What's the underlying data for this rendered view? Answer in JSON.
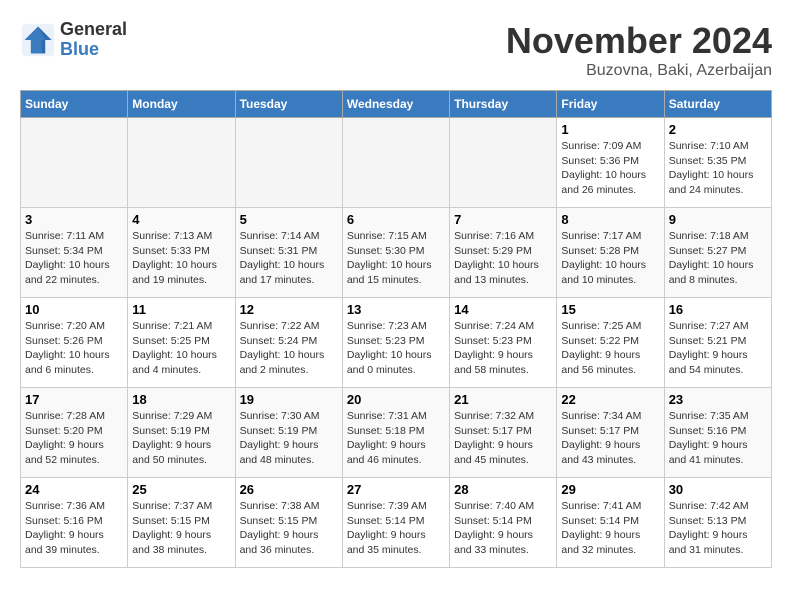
{
  "logo": {
    "general": "General",
    "blue": "Blue"
  },
  "header": {
    "month": "November 2024",
    "location": "Buzovna, Baki, Azerbaijan"
  },
  "weekdays": [
    "Sunday",
    "Monday",
    "Tuesday",
    "Wednesday",
    "Thursday",
    "Friday",
    "Saturday"
  ],
  "weeks": [
    [
      {
        "day": "",
        "info": ""
      },
      {
        "day": "",
        "info": ""
      },
      {
        "day": "",
        "info": ""
      },
      {
        "day": "",
        "info": ""
      },
      {
        "day": "",
        "info": ""
      },
      {
        "day": "1",
        "info": "Sunrise: 7:09 AM\nSunset: 5:36 PM\nDaylight: 10 hours and 26 minutes."
      },
      {
        "day": "2",
        "info": "Sunrise: 7:10 AM\nSunset: 5:35 PM\nDaylight: 10 hours and 24 minutes."
      }
    ],
    [
      {
        "day": "3",
        "info": "Sunrise: 7:11 AM\nSunset: 5:34 PM\nDaylight: 10 hours and 22 minutes."
      },
      {
        "day": "4",
        "info": "Sunrise: 7:13 AM\nSunset: 5:33 PM\nDaylight: 10 hours and 19 minutes."
      },
      {
        "day": "5",
        "info": "Sunrise: 7:14 AM\nSunset: 5:31 PM\nDaylight: 10 hours and 17 minutes."
      },
      {
        "day": "6",
        "info": "Sunrise: 7:15 AM\nSunset: 5:30 PM\nDaylight: 10 hours and 15 minutes."
      },
      {
        "day": "7",
        "info": "Sunrise: 7:16 AM\nSunset: 5:29 PM\nDaylight: 10 hours and 13 minutes."
      },
      {
        "day": "8",
        "info": "Sunrise: 7:17 AM\nSunset: 5:28 PM\nDaylight: 10 hours and 10 minutes."
      },
      {
        "day": "9",
        "info": "Sunrise: 7:18 AM\nSunset: 5:27 PM\nDaylight: 10 hours and 8 minutes."
      }
    ],
    [
      {
        "day": "10",
        "info": "Sunrise: 7:20 AM\nSunset: 5:26 PM\nDaylight: 10 hours and 6 minutes."
      },
      {
        "day": "11",
        "info": "Sunrise: 7:21 AM\nSunset: 5:25 PM\nDaylight: 10 hours and 4 minutes."
      },
      {
        "day": "12",
        "info": "Sunrise: 7:22 AM\nSunset: 5:24 PM\nDaylight: 10 hours and 2 minutes."
      },
      {
        "day": "13",
        "info": "Sunrise: 7:23 AM\nSunset: 5:23 PM\nDaylight: 10 hours and 0 minutes."
      },
      {
        "day": "14",
        "info": "Sunrise: 7:24 AM\nSunset: 5:23 PM\nDaylight: 9 hours and 58 minutes."
      },
      {
        "day": "15",
        "info": "Sunrise: 7:25 AM\nSunset: 5:22 PM\nDaylight: 9 hours and 56 minutes."
      },
      {
        "day": "16",
        "info": "Sunrise: 7:27 AM\nSunset: 5:21 PM\nDaylight: 9 hours and 54 minutes."
      }
    ],
    [
      {
        "day": "17",
        "info": "Sunrise: 7:28 AM\nSunset: 5:20 PM\nDaylight: 9 hours and 52 minutes."
      },
      {
        "day": "18",
        "info": "Sunrise: 7:29 AM\nSunset: 5:19 PM\nDaylight: 9 hours and 50 minutes."
      },
      {
        "day": "19",
        "info": "Sunrise: 7:30 AM\nSunset: 5:19 PM\nDaylight: 9 hours and 48 minutes."
      },
      {
        "day": "20",
        "info": "Sunrise: 7:31 AM\nSunset: 5:18 PM\nDaylight: 9 hours and 46 minutes."
      },
      {
        "day": "21",
        "info": "Sunrise: 7:32 AM\nSunset: 5:17 PM\nDaylight: 9 hours and 45 minutes."
      },
      {
        "day": "22",
        "info": "Sunrise: 7:34 AM\nSunset: 5:17 PM\nDaylight: 9 hours and 43 minutes."
      },
      {
        "day": "23",
        "info": "Sunrise: 7:35 AM\nSunset: 5:16 PM\nDaylight: 9 hours and 41 minutes."
      }
    ],
    [
      {
        "day": "24",
        "info": "Sunrise: 7:36 AM\nSunset: 5:16 PM\nDaylight: 9 hours and 39 minutes."
      },
      {
        "day": "25",
        "info": "Sunrise: 7:37 AM\nSunset: 5:15 PM\nDaylight: 9 hours and 38 minutes."
      },
      {
        "day": "26",
        "info": "Sunrise: 7:38 AM\nSunset: 5:15 PM\nDaylight: 9 hours and 36 minutes."
      },
      {
        "day": "27",
        "info": "Sunrise: 7:39 AM\nSunset: 5:14 PM\nDaylight: 9 hours and 35 minutes."
      },
      {
        "day": "28",
        "info": "Sunrise: 7:40 AM\nSunset: 5:14 PM\nDaylight: 9 hours and 33 minutes."
      },
      {
        "day": "29",
        "info": "Sunrise: 7:41 AM\nSunset: 5:14 PM\nDaylight: 9 hours and 32 minutes."
      },
      {
        "day": "30",
        "info": "Sunrise: 7:42 AM\nSunset: 5:13 PM\nDaylight: 9 hours and 31 minutes."
      }
    ]
  ]
}
